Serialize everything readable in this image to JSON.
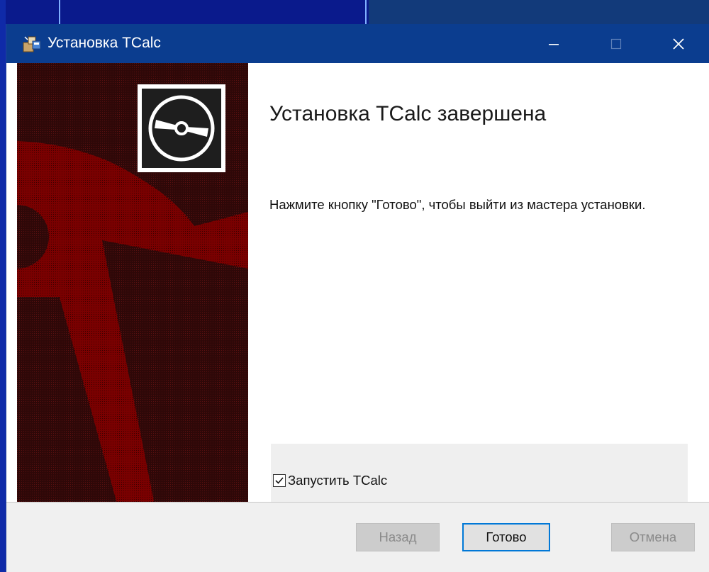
{
  "window": {
    "title": "Установка TCalc"
  },
  "content": {
    "heading": "Установка TCalc завершена",
    "message": "Нажмите кнопку \"Готово\", чтобы выйти из мастера установки."
  },
  "launch": {
    "label": "Запустить TCalc",
    "checked": true
  },
  "buttons": {
    "back": "Назад",
    "finish": "Готово",
    "cancel": "Отмена"
  },
  "icons": {
    "app": "installer-package-icon",
    "banner": "cd-disc-icon",
    "minimize": "minimize-icon",
    "maximize": "maximize-icon",
    "close": "close-icon",
    "check": "checkmark-icon"
  },
  "colors": {
    "titlebar": "#0b3d8f",
    "banner": "#7a0000",
    "accent": "#0078d7"
  }
}
